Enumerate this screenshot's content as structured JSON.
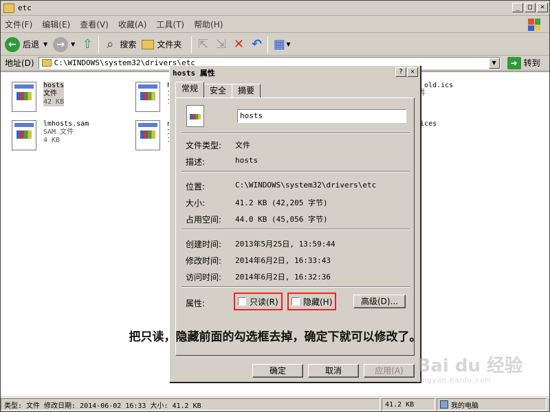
{
  "window": {
    "title": "etc",
    "controls": [
      "_",
      "□",
      "×"
    ]
  },
  "menu": [
    "文件(F)",
    "编辑(E)",
    "查看(V)",
    "收藏(A)",
    "工具(T)",
    "帮助(H)"
  ],
  "toolbar": {
    "back_label": "后退",
    "search_label": "搜索",
    "folders_label": "文件夹"
  },
  "address": {
    "label": "地址(D)",
    "value": "C:\\WINDOWS\\system32\\drivers\\etc",
    "go_label": "转到"
  },
  "files": [
    {
      "name": "hosts",
      "type": "文件",
      "size": "42 KB",
      "selected": true
    },
    {
      "name": "lmhosts.sam",
      "type": "SAM 文件",
      "size": "4 KB"
    },
    {
      "name": "h",
      "type": "1",
      "size": "1"
    },
    {
      "name": "n",
      "type": "文",
      "size": "1"
    },
    {
      "name": "ts_old.ics",
      "type": "文件",
      "size": "KB"
    },
    {
      "name": "rvices",
      "type": "",
      "size": "KB"
    }
  ],
  "statusbar": {
    "info": "类型: 文件 修改日期: 2014-06-02 16:33 大小: 41.2 KB",
    "size": "41.2 KB",
    "location": "我的电脑"
  },
  "dialog": {
    "title": "hosts 属性",
    "help": "?",
    "close": "×",
    "tabs": [
      "常规",
      "安全",
      "摘要"
    ],
    "filename": "hosts",
    "rows": {
      "type_label": "文件类型:",
      "type_value": "文件",
      "desc_label": "描述:",
      "desc_value": "hosts",
      "loc_label": "位置:",
      "loc_value": "C:\\WINDOWS\\system32\\drivers\\etc",
      "size_label": "大小:",
      "size_value": "41.2 KB (42,205 字节)",
      "disk_label": "占用空间:",
      "disk_value": "44.0 KB (45,056 字节)",
      "created_label": "创建时间:",
      "created_value": "2013年5月25日, 13:59:44",
      "modified_label": "修改时间:",
      "modified_value": "2014年6月2日, 16:33:43",
      "accessed_label": "访问时间:",
      "accessed_value": "2014年6月2日, 16:32:36",
      "attr_label": "属性:"
    },
    "readonly_label": "只读(R)",
    "hidden_label": "隐藏(H)",
    "advanced_label": "高级(D)...",
    "ok_label": "确定",
    "cancel_label": "取消",
    "apply_label": "应用(A)"
  },
  "overlay_text": "把只读，隐藏前面的勾选框去掉，确定下就可以修改了。",
  "watermark": {
    "main": "Bai du 经验",
    "sub": "jingyan.baidu.com"
  }
}
